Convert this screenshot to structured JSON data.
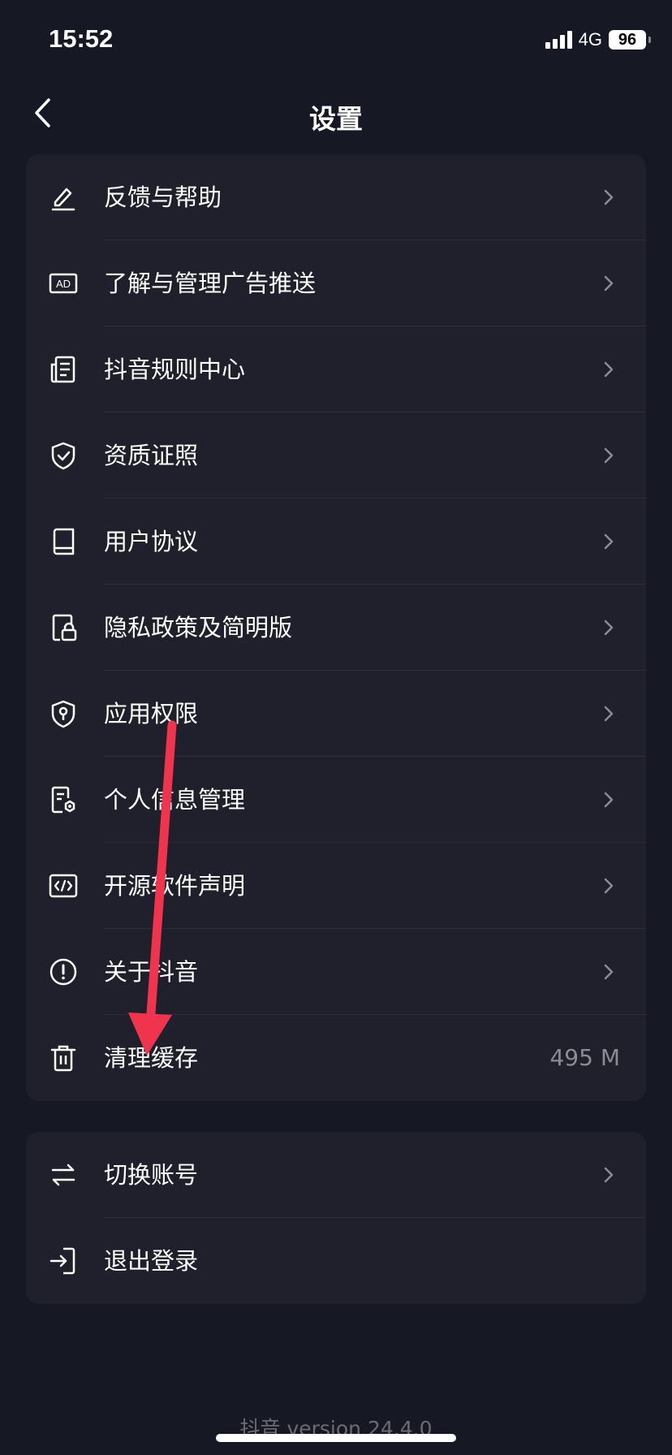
{
  "status_bar": {
    "time": "15:52",
    "network": "4G",
    "battery": "96"
  },
  "nav": {
    "title": "设置"
  },
  "main_menu": [
    {
      "label": "反馈与帮助",
      "icon": "edit-pen-icon",
      "has_chevron": true
    },
    {
      "label": "了解与管理广告推送",
      "icon": "ad-icon",
      "has_chevron": true
    },
    {
      "label": "抖音规则中心",
      "icon": "rules-document-icon",
      "has_chevron": true
    },
    {
      "label": "资质证照",
      "icon": "shield-check-icon",
      "has_chevron": true
    },
    {
      "label": "用户协议",
      "icon": "book-icon",
      "has_chevron": true
    },
    {
      "label": "隐私政策及简明版",
      "icon": "document-lock-icon",
      "has_chevron": true
    },
    {
      "label": "应用权限",
      "icon": "shield-key-icon",
      "has_chevron": true
    },
    {
      "label": "个人信息管理",
      "icon": "document-settings-icon",
      "has_chevron": true
    },
    {
      "label": "开源软件声明",
      "icon": "code-icon",
      "has_chevron": true
    },
    {
      "label": "关于抖音",
      "icon": "info-circle-icon",
      "has_chevron": true
    },
    {
      "label": "清理缓存",
      "icon": "trash-icon",
      "value": "495 M",
      "has_chevron": false
    }
  ],
  "account_menu": [
    {
      "label": "切换账号",
      "icon": "switch-arrows-icon",
      "has_chevron": true
    },
    {
      "label": "退出登录",
      "icon": "logout-icon",
      "has_chevron": false
    }
  ],
  "footer": {
    "version": "抖音 version 24.4.0"
  },
  "colors": {
    "background": "#161823",
    "card": "#1f202b",
    "annotation_arrow": "#f0344e"
  }
}
